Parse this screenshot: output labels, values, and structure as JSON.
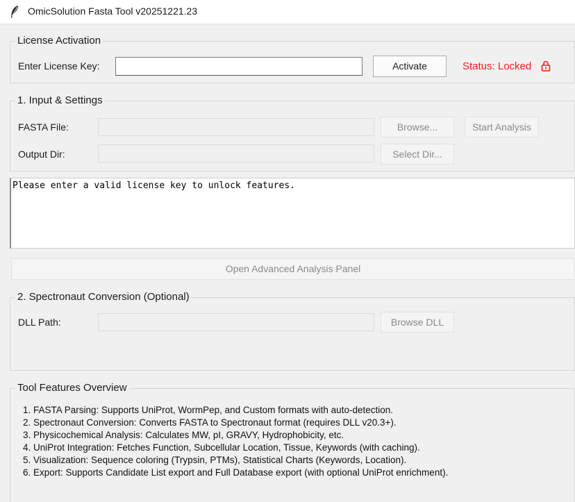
{
  "window": {
    "title": "OmicSolution Fasta Tool v20251221.23",
    "icon": "feather-icon"
  },
  "license": {
    "group_label": "License Activation",
    "key_label": "Enter License Key:",
    "key_value": "",
    "activate_label": "Activate",
    "status_text": "Status: Locked",
    "status_color": "#ff1a1a",
    "status_icon": "lock-icon"
  },
  "input": {
    "group_label": "1. Input & Settings",
    "fasta_label": "FASTA File:",
    "fasta_value": "",
    "browse_label": "Browse...",
    "start_label": "Start Analysis",
    "output_label": "Output Dir:",
    "output_value": "",
    "select_dir_label": "Select Dir..."
  },
  "log": {
    "text": "Please enter a valid license key to unlock features."
  },
  "advanced": {
    "label": "Open Advanced Analysis Panel"
  },
  "spectronaut": {
    "group_label": "2. Spectronaut Conversion (Optional)",
    "dll_label": "DLL Path:",
    "dll_value": "",
    "browse_dll_label": "Browse DLL"
  },
  "overview": {
    "group_label": "Tool Features Overview",
    "items": [
      "1. FASTA Parsing: Supports UniProt, WormPep, and Custom formats with auto-detection.",
      "2. Spectronaut Conversion: Converts FASTA to Spectronaut format (requires DLL v20.3+).",
      "3. Physicochemical Analysis: Calculates MW, pI, GRAVY, Hydrophobicity, etc.",
      "4. UniProt Integration: Fetches Function, Subcellular Location, Tissue, Keywords (with caching).",
      "5. Visualization: Sequence coloring (Trypsin, PTMs), Statistical Charts (Keywords, Location).",
      "6. Export: Supports Candidate List export and Full Database export (with optional UniProt enrichment)."
    ]
  }
}
